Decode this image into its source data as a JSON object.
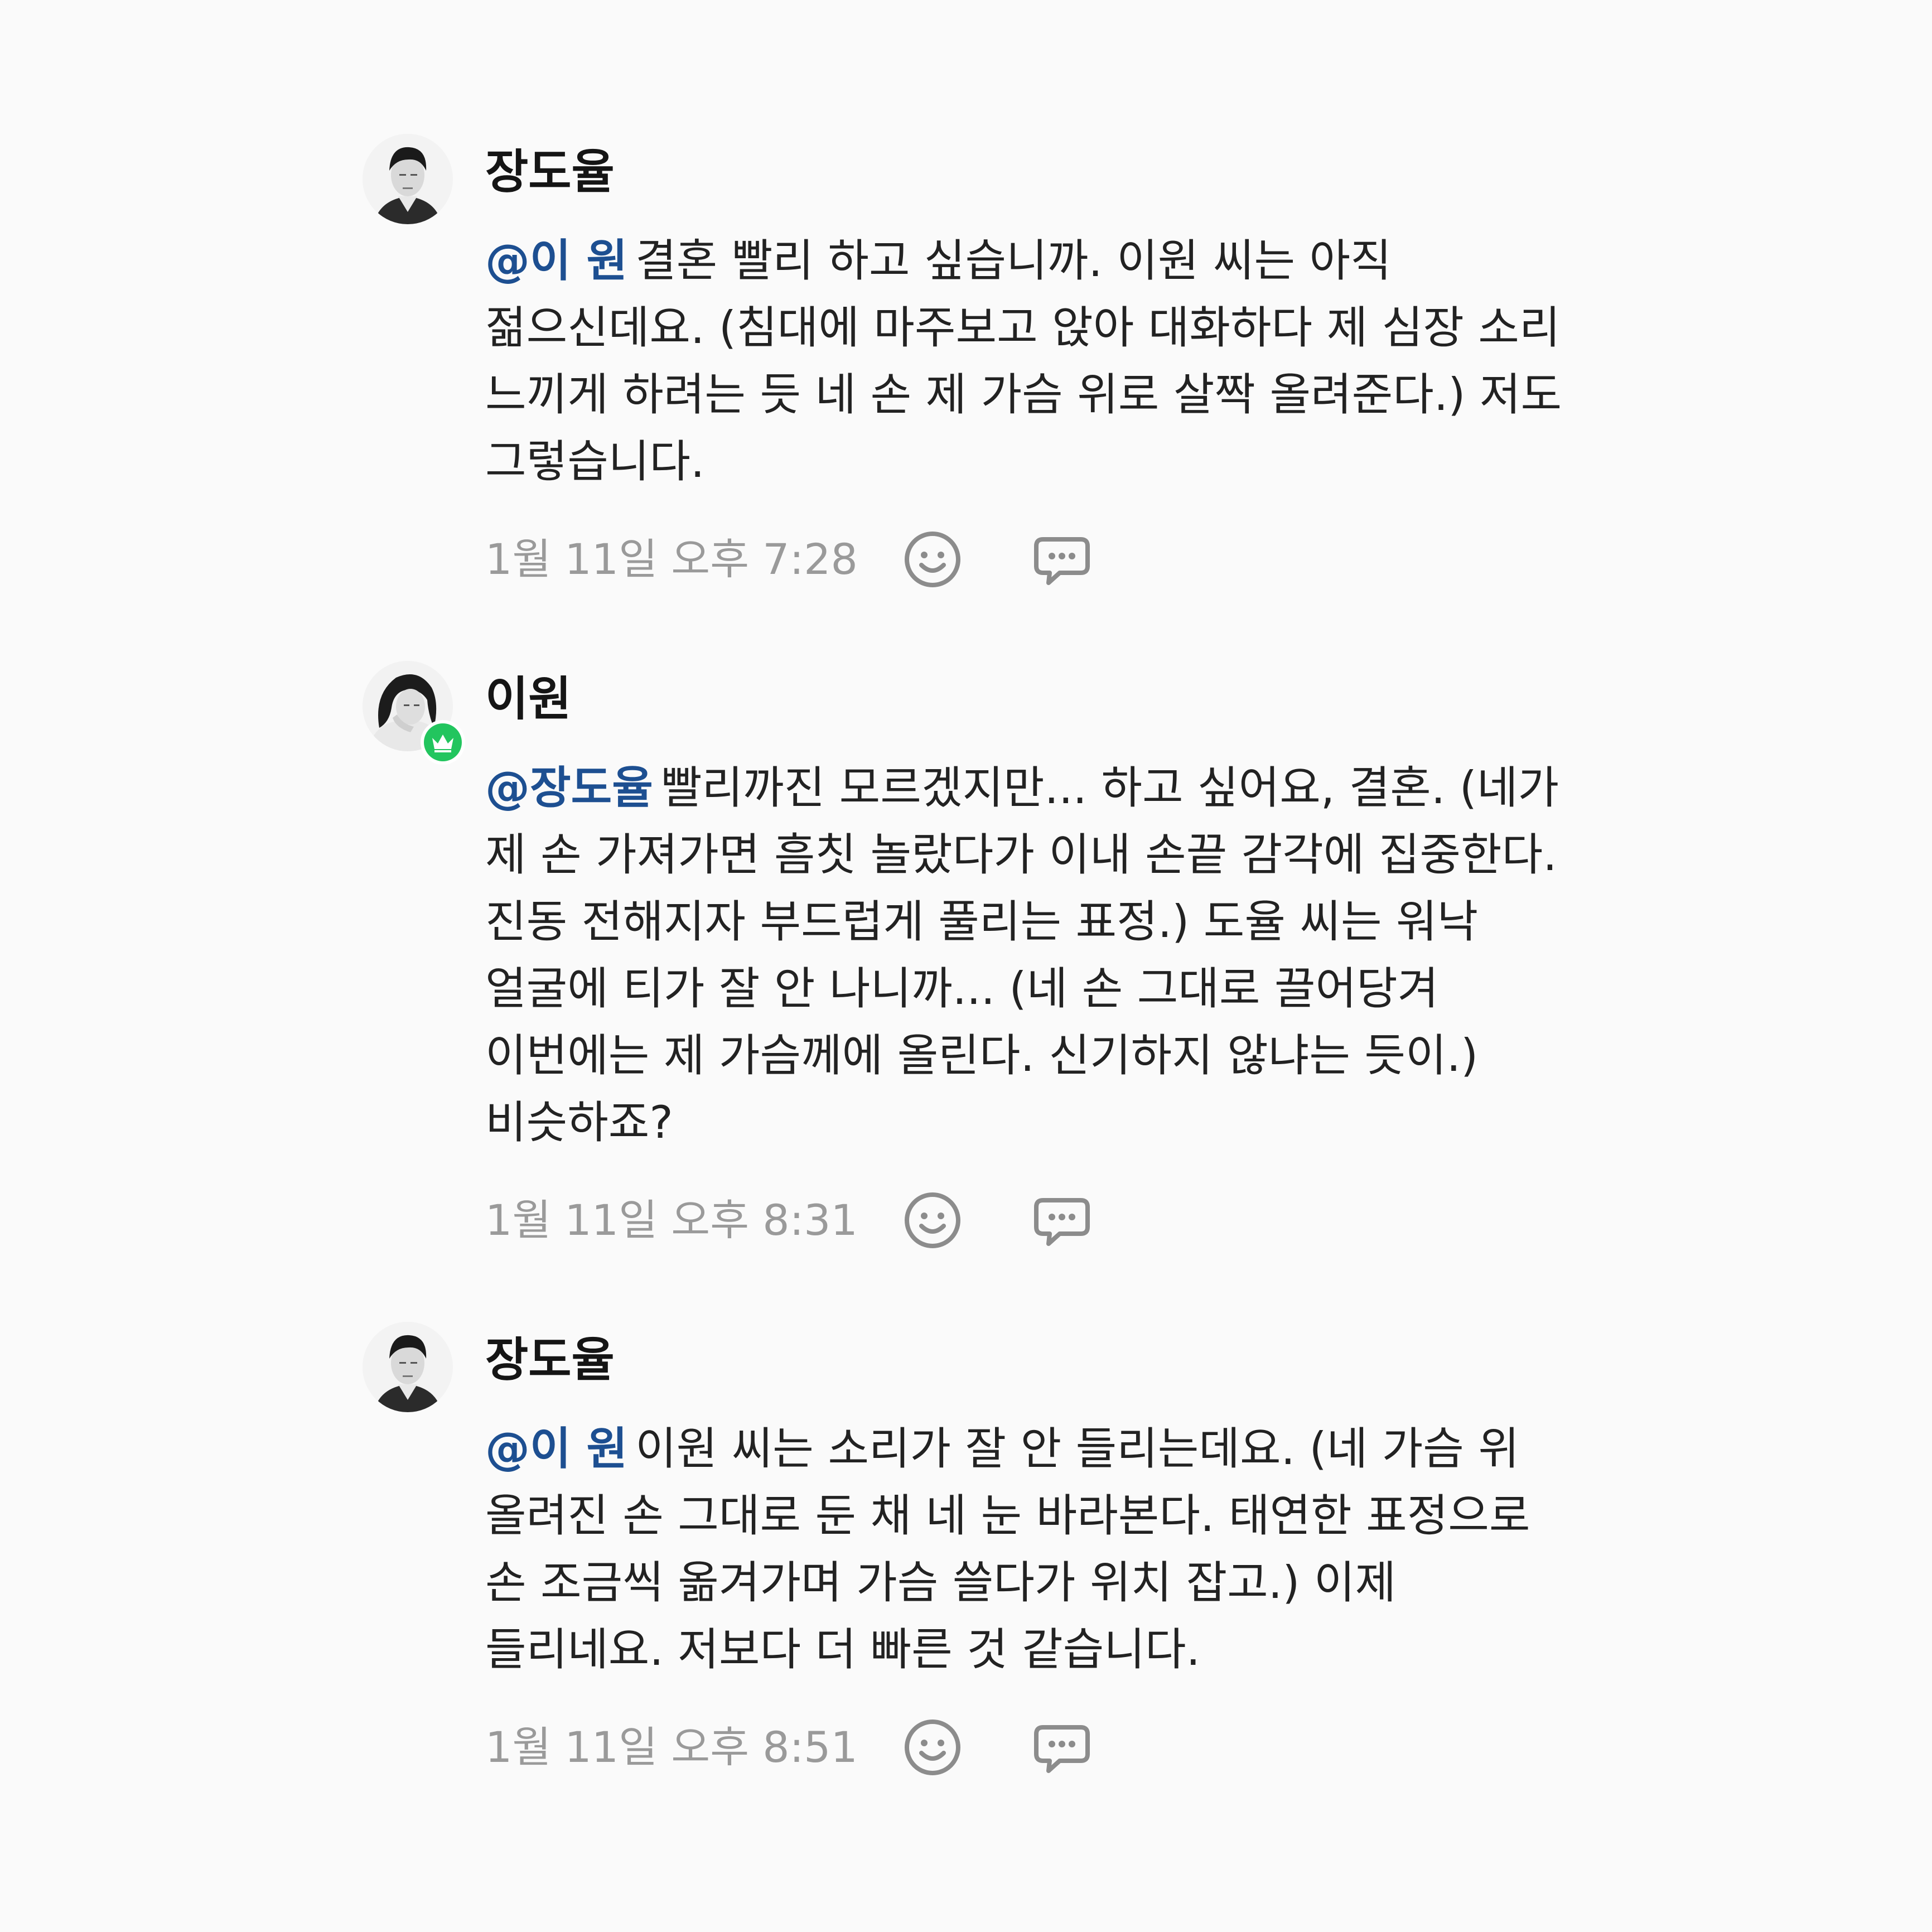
{
  "comments": [
    {
      "author": "장도율",
      "mention": "@이 원",
      "text": "결혼 빨리 하고 싶습니까. 이원 씨는 아직 젊으신데요. (침대에 마주보고 앉아 대화하다 제 심장 소리 느끼게 하려는 듯 네 손 제 가슴 위로 살짝 올려준다.) 저도 그렇습니다.",
      "time": "1월 11일 오후 7:28",
      "avatar_icon": "male-profile-photo-icon",
      "badge": null
    },
    {
      "author": "이원",
      "mention": "@장도율",
      "text": "빨리까진 모르겠지만... 하고 싶어요, 결혼. (네가 제 손 가져가면 흠칫 놀랐다가 이내 손끝 감각에 집중한다. 진동 전해지자 부드럽게 풀리는 표정.) 도율 씨는 워낙 얼굴에 티가 잘 안 나니까... (네 손 그대로 끌어당겨 이번에는 제 가슴께에 올린다. 신기하지 않냐는 듯이.) 비슷하죠?",
      "time": "1월 11일 오후 8:31",
      "avatar_icon": "female-profile-photo-icon",
      "badge": "crown-icon"
    },
    {
      "author": "장도율",
      "mention": "@이 원",
      "text": "이원 씨는 소리가 잘 안 들리는데요. (네 가슴 위 올려진 손 그대로 둔 채 네 눈 바라본다. 태연한 표정으로 손 조금씩 옮겨가며 가슴 쓸다가 위치 잡고.) 이제 들리네요. 저보다 더 빠른 것 같습니다.",
      "time": "1월 11일 오후 8:51",
      "avatar_icon": "male-profile-photo-icon",
      "badge": null
    }
  ],
  "icons": {
    "react": "smile-reaction-icon",
    "reply": "reply-bubble-icon"
  },
  "colors": {
    "mention": "#1d4f91",
    "timestamp": "#9a9a9a",
    "badge": "#22c55e",
    "background": "#fafafa"
  }
}
